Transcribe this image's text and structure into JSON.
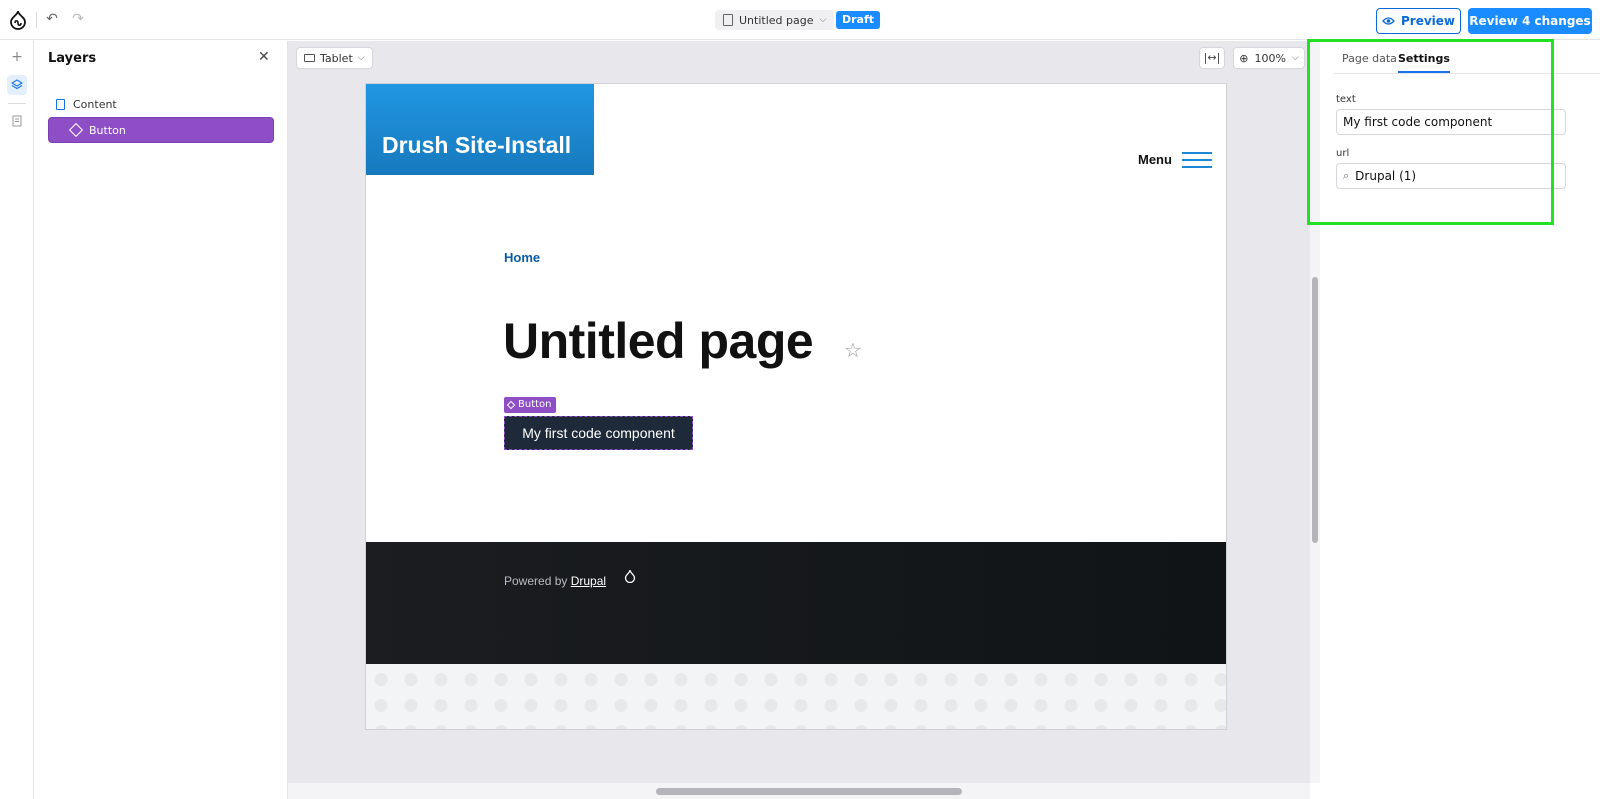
{
  "topbar": {
    "page_title": "Untitled page",
    "status_badge": "Draft",
    "preview_label": "Preview",
    "review_label": "Review 4 changes"
  },
  "layers": {
    "title": "Layers",
    "items": [
      {
        "label": "Content",
        "icon": "document-icon"
      },
      {
        "label": "Button",
        "icon": "component-icon",
        "selected": true
      }
    ]
  },
  "canvas": {
    "device_label": "Tablet",
    "zoom_label": "100%"
  },
  "site": {
    "site_name": "Drush Site-Install",
    "menu_label": "Menu",
    "breadcrumb": "Home",
    "page_heading": "Untitled page",
    "component_tag": "Button",
    "button_text": "My first code component",
    "footer_prefix": "Powered by",
    "footer_link": "Drupal"
  },
  "settings": {
    "tabs": [
      "Page data",
      "Settings"
    ],
    "active_tab": "Settings",
    "fields": [
      {
        "label": "text",
        "value": "My first code component"
      },
      {
        "label": "url",
        "value": "Drupal (1)"
      }
    ]
  },
  "colors": {
    "accent": "#1a8cff",
    "component_purple": "#8e4ec6",
    "highlight_outline": "#22e022"
  }
}
